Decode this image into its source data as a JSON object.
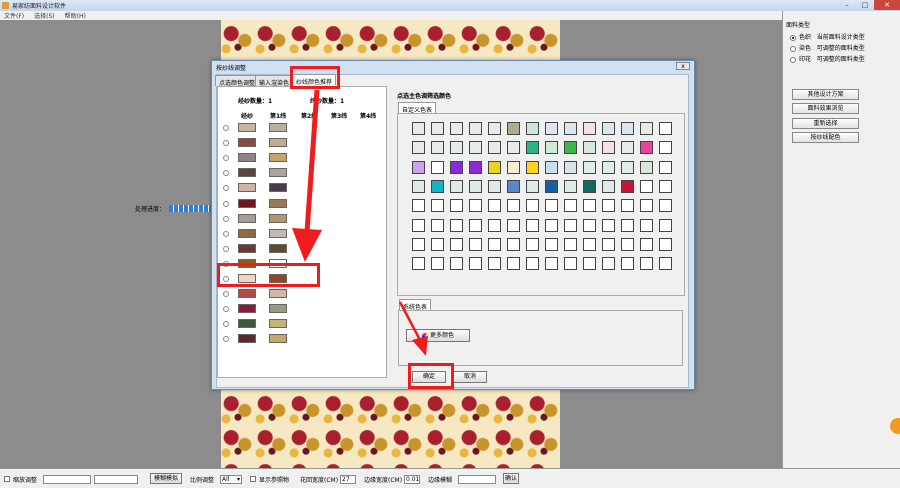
{
  "app": {
    "title": "易家纺面料设计软件",
    "menu": [
      "文件(F)",
      "选择(S)",
      "帮助(H)"
    ],
    "bg_title": "易家纺面料设计软件"
  },
  "progress": {
    "label": "处理进度："
  },
  "right_panel": {
    "group_title": "面料类型",
    "types": [
      {
        "name": "色织",
        "desc": "当前面料设计类型",
        "selected": true
      },
      {
        "name": "染色",
        "desc": "可调整的面料类型",
        "selected": false
      },
      {
        "name": "印花",
        "desc": "可调整的面料类型",
        "selected": false
      }
    ],
    "buttons": [
      "其他设计方案",
      "面料效果浏览",
      "重新选择",
      "按纱线配色"
    ]
  },
  "dialog": {
    "title": "按纱线调整",
    "close": "x",
    "tabs": [
      "点选颜色调整",
      "输入渲染色",
      "纱线颜色推荐"
    ],
    "warp_count_label": "经纱数量：1",
    "weft_count_label": "纬纱数量：1",
    "columns": [
      "经纱",
      "第1纬",
      "第2纬",
      "第3纬",
      "第4纬"
    ],
    "yarn_rows": [
      {
        "warp": "#c6b6a4",
        "weft": "#b9b0a2",
        "selected": false
      },
      {
        "warp": "#8a4a3f",
        "weft": "#c9a891",
        "selected": false
      },
      {
        "warp": "#8c8583",
        "weft": "#c6a36a",
        "selected": false
      },
      {
        "warp": "#5c4643",
        "weft": "#a9a6a0",
        "selected": false
      },
      {
        "warp": "#d2b4a4",
        "weft": "#4a3b4b",
        "selected": false
      },
      {
        "warp": "#6e1720",
        "weft": "#9a7a55",
        "selected": false
      },
      {
        "warp": "#a29f98",
        "weft": "#b8956b",
        "selected": false
      },
      {
        "warp": "#8b6a4c",
        "weft": "#c2b9b3",
        "selected": false
      },
      {
        "warp": "#6b3a2e",
        "weft": "#5e4a2c",
        "selected": false
      },
      {
        "warp": "#8c5a22",
        "weft": "#ffffff",
        "selected": true
      },
      {
        "warp": "#f2d3c1",
        "weft": "#8c4a20",
        "selected": false
      },
      {
        "warp": "#b44a45",
        "weft": "#d0b8a4",
        "selected": false
      },
      {
        "warp": "#8c1a3a",
        "weft": "#9a9a82",
        "selected": false
      },
      {
        "warp": "#3a5a3a",
        "weft": "#c8b27a",
        "selected": false
      },
      {
        "warp": "#5a2a2a",
        "weft": "#c8a868",
        "selected": false
      }
    ],
    "palette_title": "点选主色调筛选颜色",
    "custom_tab": "自定义色表",
    "palette_rows": [
      [
        "#e6ece6",
        "#e6ece6",
        "#e6ece6",
        "#e6ece6",
        "#e6ece6",
        "#b0ab8f",
        "#cfe2df",
        "#dde6ef",
        "#dde6ef",
        "#f5e0e6",
        "#dde6ef",
        "#dde6ef",
        "#e6ece6"
      ],
      [
        "#e6ece6",
        "#e6ece6",
        "#e6ece6",
        "#e6ece6",
        "#e6ece6",
        "#e6ece6",
        "#2fb38a",
        "#d0ead8",
        "#3cb94e",
        "#d7e7dd",
        "#f7e0e5",
        "#e6ece6",
        "#e9439b"
      ],
      [
        "#c9a2f0",
        "#ffffff",
        "#8b2ad9",
        "#8b2ad9",
        "#e7d51f",
        "#f7ebd8",
        "#f6d41f",
        "#c9def0",
        "#d9e4e8",
        "#e0ecec",
        "#e0ecec",
        "#e0ecec",
        "#d8e8d8"
      ],
      [
        "#dfe9ea",
        "#13b6c9",
        "#dfe9ea",
        "#dfe9ea",
        "#dfe9ea",
        "#5d86c8",
        "#dfe9ea",
        "#1660a2",
        "#dfe9ea",
        "#0f6c5e",
        "#dfe9ea",
        "#c4163d",
        "#ffffff",
        "#ffffff"
      ]
    ],
    "empty_rows": 4,
    "cols": 14,
    "sys_tab": "系统色表",
    "more_colors": "更多颜色",
    "ok": "确定",
    "cancel": "取消"
  },
  "status": {
    "zoom_check": "缩放调整",
    "fuzzy_btn": "模糊模拟",
    "ratio_label": "比例调整",
    "ratio_value": "All",
    "show_ref": "显示参照物",
    "pattern_width": "花回宽度(CM)",
    "pattern_value": "27",
    "edge_width": "边缘宽度(CM)",
    "edge_value": "0.01",
    "edge_blur": "边缘模糊",
    "confirm": "确认"
  }
}
